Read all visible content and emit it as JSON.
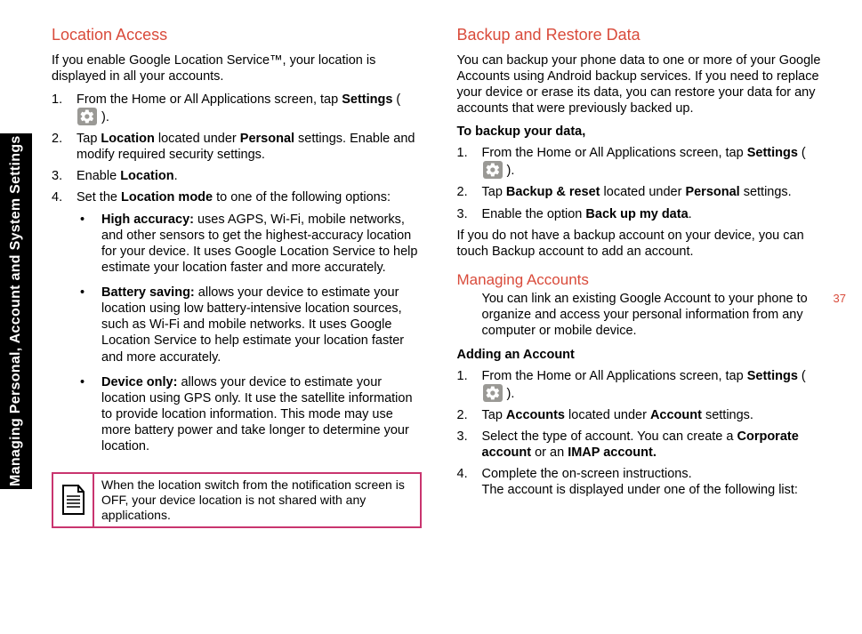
{
  "sideTab": "Managing Personal, Account and System Settings",
  "pageNumber": "37",
  "left": {
    "h1": "Location Access",
    "intro": "If you enable Google Location Service™, your location is displayed in all your accounts.",
    "step1a": "From the Home or All Applications screen, tap ",
    "step1b": "Settings",
    "step1c": " ( ",
    "step1d": " ).",
    "step2a": "Tap ",
    "step2b": "Location",
    "step2c": " located under ",
    "step2d": "Personal",
    "step2e": " settings. Enable and modify required security settings.",
    "step3a": "Enable ",
    "step3b": "Location",
    "step3c": ".",
    "step4a": "Set the ",
    "step4b": "Location mode",
    "step4c": " to one of the following options:",
    "b1t": "High accuracy:",
    "b1": " uses AGPS, Wi-Fi, mobile networks, and other sensors to get the highest-accuracy location for your device. It uses Google Location Service to help estimate your location faster and more accurately.",
    "b2t": "Battery saving:",
    "b2": " allows your device to estimate your location using low battery-intensive location sources, such as Wi-Fi and mobile networks. It uses Google Location Service to help estimate your location faster and more accurately.",
    "b3t": "Device only:",
    "b3": " allows your device to estimate your location using GPS only. It use the satellite information to provide location information. This mode may use more battery power and take longer to determine your location.",
    "note": "When the location switch from the notification screen is OFF, your device location is not shared with any applications."
  },
  "right": {
    "h1": "Backup and Restore Data",
    "intro": "You can backup your phone data to one or more of your Google Accounts using Android backup services. If you need to replace your device or erase its data, you can restore your data for any accounts that were previously backed up.",
    "sub1": "To backup your data,",
    "s1a": "From the Home or All Applications screen, tap ",
    "s1b": "Settings",
    "s1c": " ( ",
    "s1d": " ).",
    "s2a": "Tap ",
    "s2b": "Backup & reset",
    "s2c": " located under ",
    "s2d": "Personal",
    "s2e": " settings.",
    "s3a": "Enable the option ",
    "s3b": "Back up my data",
    "s3c": ".",
    "afterBackup": "If you do not have a backup account on your device, you can touch Backup account to add an account.",
    "h2": "Managing Accounts",
    "mIntro": "You can link an existing Google Account to your phone to organize and access your personal information from any computer or mobile device.",
    "sub2": "Adding an Account",
    "a1a": "From the Home or All Applications screen, tap ",
    "a1b": "Settings",
    "a1c": " ( ",
    "a1d": " ).",
    "a2a": "Tap ",
    "a2b": "Accounts",
    "a2c": " located under ",
    "a2d": "Account",
    "a2e": " settings.",
    "a3a": "Select the type of account. You can create a ",
    "a3b": "Corporate account",
    "a3c": " or an ",
    "a3d": "IMAP account.",
    "a4": "Complete the on-screen instructions.",
    "a4b": "The account is displayed under one of the following list:"
  }
}
